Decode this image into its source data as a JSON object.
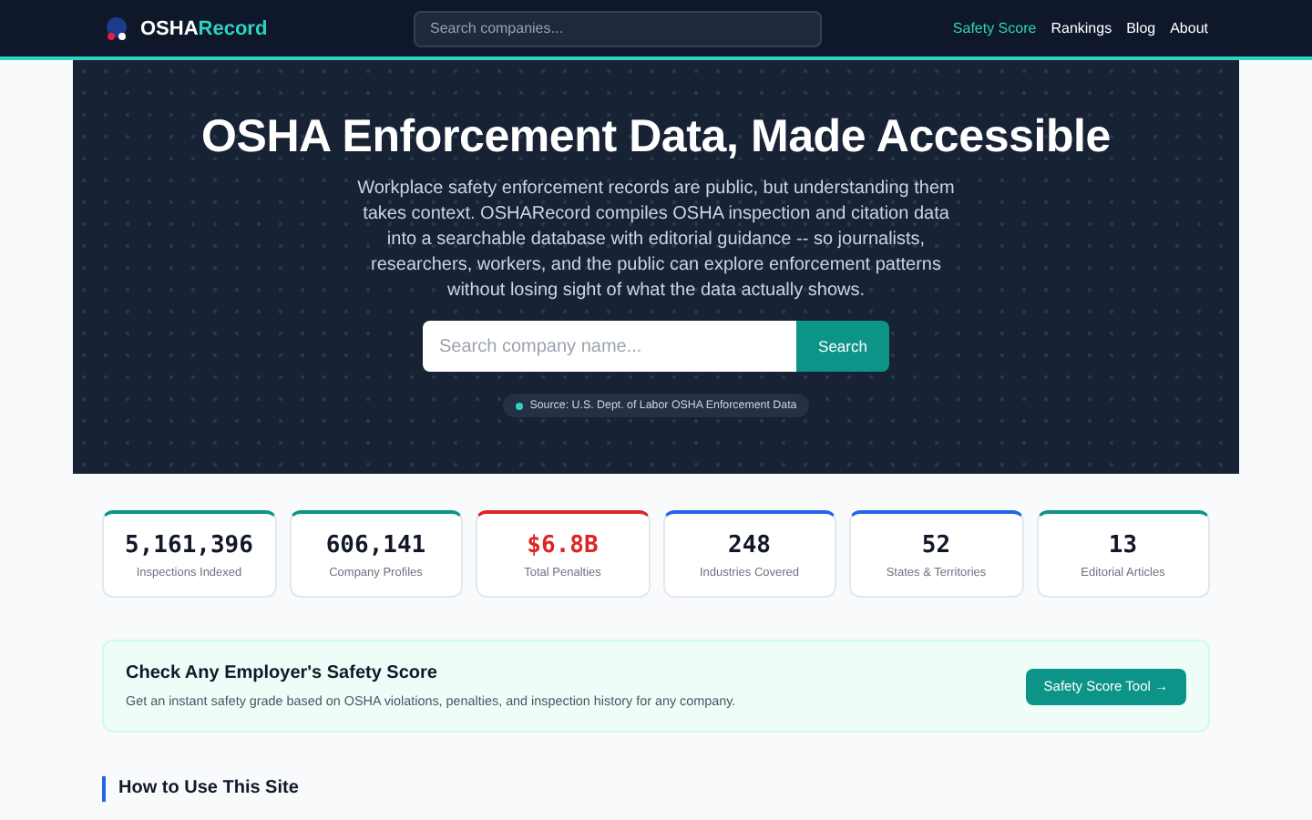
{
  "brand": {
    "first": "OSHA",
    "second": "Record"
  },
  "nav_search": {
    "placeholder": "Search companies..."
  },
  "nav": [
    {
      "label": "Safety Score",
      "selected": true
    },
    {
      "label": "Rankings",
      "selected": false
    },
    {
      "label": "Blog",
      "selected": false
    },
    {
      "label": "About",
      "selected": false
    }
  ],
  "hero": {
    "title": "OSHA Enforcement Data, Made Accessible",
    "text": "Workplace safety enforcement records are public, but understanding them takes context. OSHARecord compiles OSHA inspection and citation data into a searchable database with editorial guidance -- so journalists, researchers, workers, and the public can explore enforcement patterns without losing sight of what the data actually shows.",
    "search": {
      "placeholder": "Search company name..."
    },
    "button": "Search",
    "source": "Source: U.S. Dept. of Labor OSHA Enforcement Data"
  },
  "stats": [
    {
      "value": "5,161,396",
      "label": "Inspections Indexed",
      "color": "#0d9488"
    },
    {
      "value": "606,141",
      "label": "Company Profiles",
      "color": "#0d9488"
    },
    {
      "value": "$6.8B",
      "label": "Total Penalties",
      "color": "#dc2626"
    },
    {
      "value": "248",
      "label": "Industries Covered",
      "color": "#2563eb"
    },
    {
      "value": "52",
      "label": "States & Territories",
      "color": "#2563eb"
    },
    {
      "value": "13",
      "label": "Editorial Articles",
      "color": "#0d9488"
    }
  ],
  "banner": {
    "title": "Check Any Employer's Safety Score",
    "text": "Get an instant safety grade based on OSHA violations, penalties, and inspection history for any company.",
    "button": "Safety Score Tool →"
  },
  "section_heading": "How to Use This Site"
}
